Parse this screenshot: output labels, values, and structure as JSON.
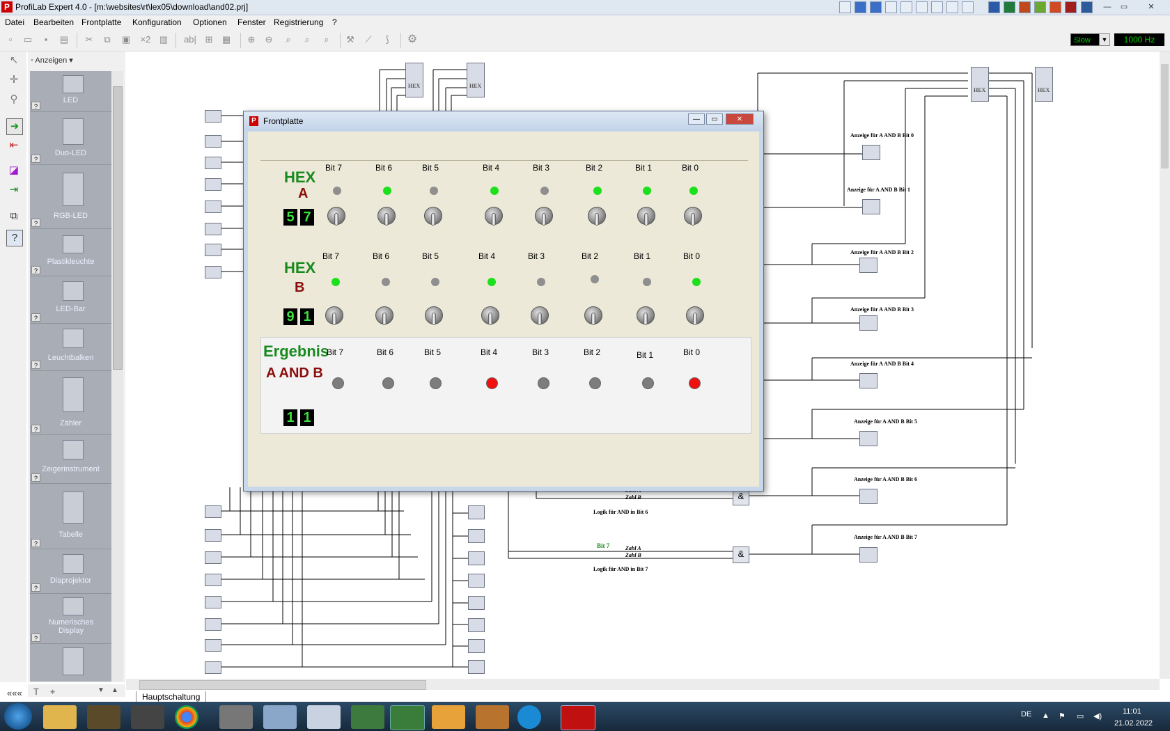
{
  "window": {
    "title": "ProfiLab Expert 4.0 - [m:\\websites\\rt\\lex05\\download\\and02.prj]"
  },
  "menu": [
    "Datei",
    "Bearbeiten",
    "Frontplatte",
    "Konfiguration",
    "Optionen",
    "Fenster",
    "Registrierung",
    "?"
  ],
  "toolbar": {
    "speed": "Slow",
    "frequency": "1000 Hz",
    "count_label": "×2"
  },
  "palette": {
    "view_label": "Anzeigen",
    "items": [
      {
        "label": "LED",
        "tag": "LED0"
      },
      {
        "label": "Duo-LED",
        "tag": "DLED0"
      },
      {
        "label": "RGB-LED",
        "tag": "RGBC"
      },
      {
        "label": "Plastikleuchte",
        "tag": "LA0"
      },
      {
        "label": "LED-Bar",
        "tag": "LB0"
      },
      {
        "label": "Leuchtbalken",
        "tag": "LB0"
      },
      {
        "label": "Zähler",
        "tag": "C00"
      },
      {
        "label": "Zeigerinstrument",
        "tag": "M0"
      },
      {
        "label": "Tabelle",
        "tag": "TAB0"
      },
      {
        "label": "Diaprojektor",
        "tag": "PJ0"
      },
      {
        "label": "Numerisches Display",
        "tag": "ND0"
      }
    ],
    "footer_left": "«««"
  },
  "canvas": {
    "tab": "Hauptschaltung",
    "led_labels": [
      "Anzeige für A AND B Bit 0",
      "Anzeige für A AND B Bit 1",
      "Anzeige für A AND B Bit 2",
      "Anzeige für A AND B Bit 3",
      "Anzeige für A AND B Bit 4",
      "Anzeige für A AND B Bit 5",
      "Anzeige für A AND B Bit 6",
      "Anzeige für A AND B Bit 7"
    ],
    "logic_label_6": "Logik für AND in Bit 6",
    "logic_label_7": "Logik für AND in Bit 7",
    "bit7_label": "Bit 7",
    "zahl_a": "Zahl A",
    "zahl_b": "Zahl B",
    "and_symbol": "&",
    "hex_block": "HEX"
  },
  "frontplatte": {
    "title": "Frontplatte",
    "bit_labels": [
      "Bit 7",
      "Bit 6",
      "Bit 5",
      "Bit 4",
      "Bit 3",
      "Bit 2",
      "Bit 1",
      "Bit 0"
    ],
    "a": {
      "hex_word": "HEX",
      "letter": "A",
      "digits": [
        "5",
        "7"
      ],
      "leds": [
        0,
        1,
        0,
        1,
        0,
        1,
        1,
        1
      ]
    },
    "b": {
      "hex_word": "HEX",
      "letter": "B",
      "digits": [
        "9",
        "1"
      ],
      "leds": [
        1,
        0,
        0,
        1,
        0,
        0,
        0,
        1
      ]
    },
    "result": {
      "title": "Ergebnis",
      "subtitle": "A AND B",
      "digits": [
        "1",
        "1"
      ],
      "leds": [
        0,
        0,
        0,
        1,
        0,
        0,
        0,
        1
      ]
    }
  },
  "taskbar": {
    "language": "DE",
    "time": "11:01",
    "date": "21.02.2022"
  }
}
